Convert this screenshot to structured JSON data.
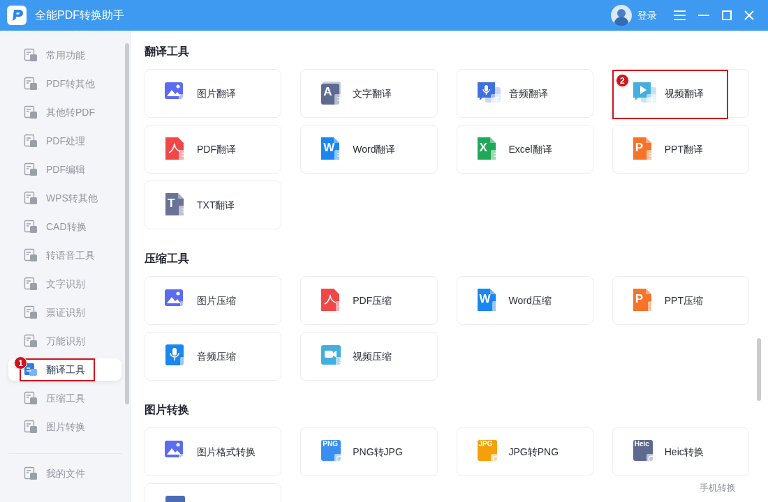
{
  "window": {
    "title": "全能PDF转换助手",
    "login": "登录"
  },
  "sidebar": {
    "items": [
      {
        "label": "常用功能",
        "selected": false
      },
      {
        "label": "PDF转其他",
        "selected": false
      },
      {
        "label": "其他转PDF",
        "selected": false
      },
      {
        "label": "PDF处理",
        "selected": false
      },
      {
        "label": "PDF编辑",
        "selected": false
      },
      {
        "label": "WPS转其他",
        "selected": false
      },
      {
        "label": "CAD转换",
        "selected": false
      },
      {
        "label": "转语音工具",
        "selected": false
      },
      {
        "label": "文字识别",
        "selected": false
      },
      {
        "label": "票证识别",
        "selected": false
      },
      {
        "label": "万能识别",
        "selected": false
      },
      {
        "label": "翻译工具",
        "selected": true,
        "marker": "1"
      },
      {
        "label": "压缩工具",
        "selected": false
      },
      {
        "label": "图片转换",
        "selected": false
      }
    ],
    "footer_item": {
      "label": "我的文件",
      "selected": false
    }
  },
  "sections": [
    {
      "title": "翻译工具",
      "kind": "translate",
      "tools": [
        {
          "label": "图片翻译",
          "kind": "image",
          "color": "#5b6cf0"
        },
        {
          "label": "文字翻译",
          "kind": "doc",
          "color": "#5e6a90",
          "icon_text": "A"
        },
        {
          "label": "音频翻译",
          "kind": "mic-bubble",
          "color": "#3f6fe0"
        },
        {
          "label": "视频翻译",
          "kind": "play-bubble",
          "color": "#45aee0",
          "marker": "2"
        },
        {
          "label": "PDF翻译",
          "kind": "pdf",
          "color": "#f04848"
        },
        {
          "label": "Word翻译",
          "kind": "file",
          "color": "#1a86f0",
          "icon_text": "W"
        },
        {
          "label": "Excel翻译",
          "kind": "file",
          "color": "#20a858",
          "icon_text": "X"
        },
        {
          "label": "PPT翻译",
          "kind": "file",
          "color": "#f5732a",
          "icon_text": "P"
        },
        {
          "label": "TXT翻译",
          "kind": "file",
          "color": "#6a7396",
          "icon_text": "T"
        }
      ]
    },
    {
      "title": "压缩工具",
      "kind": "zip",
      "tools": [
        {
          "label": "图片压缩",
          "kind": "image",
          "color": "#5b6cf0"
        },
        {
          "label": "PDF压缩",
          "kind": "pdf",
          "color": "#f04848"
        },
        {
          "label": "Word压缩",
          "kind": "file",
          "color": "#1a86f0",
          "icon_text": "W"
        },
        {
          "label": "PPT压缩",
          "kind": "file",
          "color": "#f5732a",
          "icon_text": "P"
        },
        {
          "label": "音频压缩",
          "kind": "mic",
          "color": "#1a86f0"
        },
        {
          "label": "视频压缩",
          "kind": "camera",
          "color": "#45aee0"
        }
      ]
    },
    {
      "title": "图片转换",
      "kind": "convert",
      "tools": [
        {
          "label": "图片格式转换",
          "kind": "image",
          "color": "#5b6cf0"
        },
        {
          "label": "PNG转JPG",
          "kind": "tag",
          "color": "#3a8ef0",
          "icon_text": "PNG"
        },
        {
          "label": "JPG转PNG",
          "kind": "tag",
          "color": "#f5a00a",
          "icon_text": "JPG"
        },
        {
          "label": "Heic转换",
          "kind": "tag",
          "color": "#5e6a90",
          "icon_text": "Heic"
        },
        {
          "kind": "tag",
          "color": "#4d6bb5"
        }
      ]
    }
  ],
  "floating_link": "手机转换"
}
